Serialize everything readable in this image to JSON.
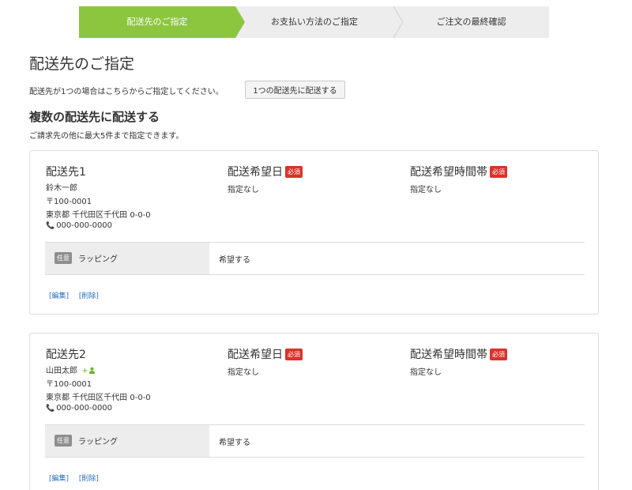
{
  "steps": [
    {
      "label": "配送先のご指定"
    },
    {
      "label": "お支払い方法のご指定"
    },
    {
      "label": "ご注文の最終確認"
    }
  ],
  "page_title": "配送先のご指定",
  "single_note": "配送先が1つの場合はこちらからご指定してください。",
  "single_button": "1つの配送先に配送する",
  "multi_title": "複数の配送先に配送する",
  "multi_note": "ご請求先の他に最大5件まで指定できます。",
  "labels": {
    "date_title": "配送希望日",
    "time_title": "配送希望時間帯",
    "required": "必須",
    "optional": "任意",
    "wrapping": "ラッピング",
    "edit": "[編集]",
    "delete": "[削除]"
  },
  "colors": {
    "accent": "#8cc63f",
    "required": "#d9332a",
    "link": "#2a6ebb"
  },
  "destinations": [
    {
      "title": "配送先1",
      "name": "鈴木一郎",
      "postal": "〒100-0001",
      "address": "東京都 千代田区千代田 0-0-0",
      "phone": "000-000-0000",
      "date": "指定なし",
      "time": "指定なし",
      "wrapping_value": "希望する"
    },
    {
      "title": "配送先2",
      "name": "山田太郎",
      "postal": "〒100-0001",
      "address": "東京都 千代田区千代田 0-0-0",
      "phone": "000-000-0000",
      "date": "指定なし",
      "time": "指定なし",
      "wrapping_value": "希望する"
    }
  ],
  "icons": {
    "phone": "phone-icon",
    "person_add": "person-add-icon"
  }
}
